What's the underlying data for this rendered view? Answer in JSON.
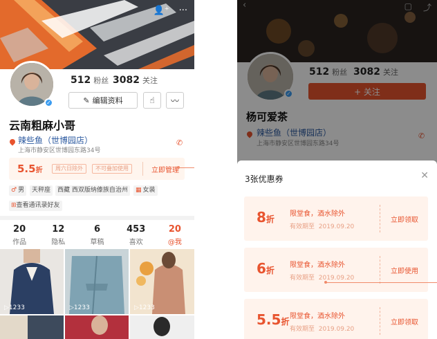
{
  "left_profile": {
    "fans_count": "512",
    "fans_label": "粉丝",
    "follow_count": "3082",
    "follow_label": "关注",
    "edit_button": "编辑资料",
    "username": "云南粗麻小哥",
    "shop_name": "辣些鱼（世博园店）",
    "shop_address": "上海市静安区世博园东路34号",
    "coupon_discount": "5.5",
    "coupon_unit": "折",
    "coupon_tags": [
      "周六日除外",
      "不可叠加使用"
    ],
    "coupon_manage": "立即管理",
    "chips": [
      "男",
      "天秤座",
      "西藏 西双版纳傣族自治州",
      "女装"
    ],
    "contacts_chip": "查看通讯录好友",
    "tabs": [
      {
        "count": "20",
        "label": "作品"
      },
      {
        "count": "12",
        "label": "隐私"
      },
      {
        "count": "6",
        "label": "草稿"
      },
      {
        "count": "453",
        "label": "喜欢"
      },
      {
        "count": "20",
        "label": "@我"
      }
    ],
    "grid_counts": [
      "1233",
      "1233",
      "1233"
    ]
  },
  "right_profile": {
    "fans_count": "512",
    "fans_label": "粉丝",
    "follow_count": "3082",
    "follow_label": "关注",
    "follow_button": "+ 关注",
    "username": "杨可爱茶",
    "shop_name": "辣些鱼（世博园店）",
    "shop_address": "上海市静安区世博园东路34号"
  },
  "coupon_sheet": {
    "title": "3张优惠券",
    "close_icon": "close-icon",
    "coupons": [
      {
        "discount": "8",
        "unit": "折",
        "desc": "限堂食，酒水除外",
        "valid_label": "有效期至",
        "valid_date": "2019.09.20",
        "action": "立即领取"
      },
      {
        "discount": "6",
        "unit": "折",
        "desc": "限堂食，酒水除外",
        "valid_label": "有效期至",
        "valid_date": "2019.09.20",
        "action": "立即使用"
      },
      {
        "discount": "5.5",
        "unit": "折",
        "desc": "限堂食，酒水除外",
        "valid_label": "有效期至",
        "valid_date": "2019.09.20",
        "action": "立即领取"
      }
    ]
  },
  "colors": {
    "accent": "#e8542f",
    "coupon_bg": "#fff3ec",
    "link": "#2c5aa0"
  }
}
